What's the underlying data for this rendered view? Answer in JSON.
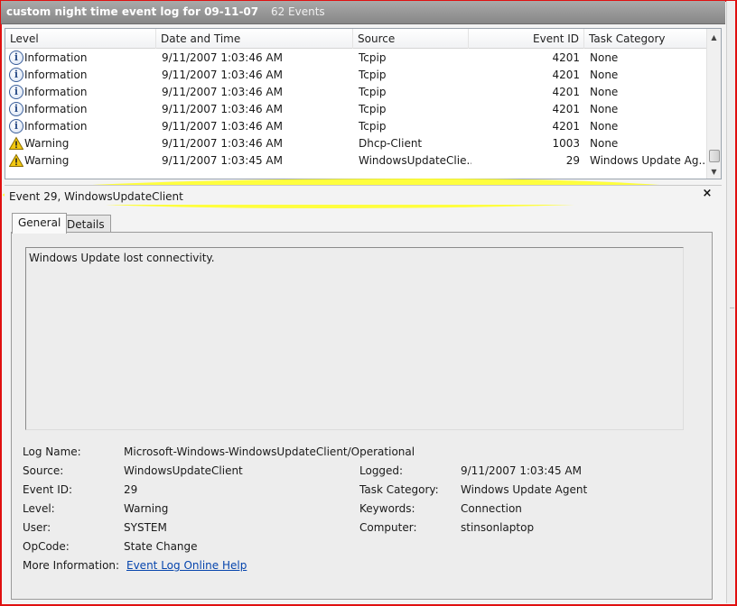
{
  "window": {
    "title": "custom night time event log for 09-11-07",
    "count": "62 Events"
  },
  "grid": {
    "columns": [
      "Level",
      "Date and Time",
      "Source",
      "Event ID",
      "Task Category"
    ],
    "rows": [
      {
        "icon": "information-icon",
        "level": "Information",
        "date": "9/11/2007 1:03:46 AM",
        "source": "Tcpip",
        "id": "4201",
        "task": "None"
      },
      {
        "icon": "information-icon",
        "level": "Information",
        "date": "9/11/2007 1:03:46 AM",
        "source": "Tcpip",
        "id": "4201",
        "task": "None"
      },
      {
        "icon": "information-icon",
        "level": "Information",
        "date": "9/11/2007 1:03:46 AM",
        "source": "Tcpip",
        "id": "4201",
        "task": "None"
      },
      {
        "icon": "information-icon",
        "level": "Information",
        "date": "9/11/2007 1:03:46 AM",
        "source": "Tcpip",
        "id": "4201",
        "task": "None"
      },
      {
        "icon": "information-icon",
        "level": "Information",
        "date": "9/11/2007 1:03:46 AM",
        "source": "Tcpip",
        "id": "4201",
        "task": "None"
      },
      {
        "icon": "warning-icon",
        "level": "Warning",
        "date": "9/11/2007 1:03:46 AM",
        "source": "Dhcp-Client",
        "id": "1003",
        "task": "None"
      },
      {
        "icon": "warning-icon",
        "level": "Warning",
        "date": "9/11/2007 1:03:45 AM",
        "source": "WindowsUpdateClie...",
        "id": "29",
        "task": "Windows Update Ag..."
      }
    ],
    "highlight_color": "#ffff24"
  },
  "detail": {
    "title": "Event 29, WindowsUpdateClient",
    "close": "×",
    "tabs": [
      "General",
      "Details"
    ],
    "description": "Windows Update lost connectivity.",
    "fields": {
      "log_name_label": "Log Name:",
      "log_name": "Microsoft-Windows-WindowsUpdateClient/Operational",
      "source_label": "Source:",
      "source": "WindowsUpdateClient",
      "logged_label": "Logged:",
      "logged": "9/11/2007 1:03:45 AM",
      "event_id_label": "Event ID:",
      "event_id": "29",
      "task_label": "Task Category:",
      "task": "Windows Update Agent",
      "level_label": "Level:",
      "level": "Warning",
      "keywords_label": "Keywords:",
      "keywords": "Connection",
      "user_label": "User:",
      "user": "SYSTEM",
      "computer_label": "Computer:",
      "computer": "stinsonlaptop",
      "opcode_label": "OpCode:",
      "opcode": "State Change",
      "more_label": "More Information:",
      "more_link": "Event Log Online Help"
    }
  },
  "colors": {
    "frame": "#e01010",
    "titlebar": "#878787",
    "link": "#0645ad"
  }
}
